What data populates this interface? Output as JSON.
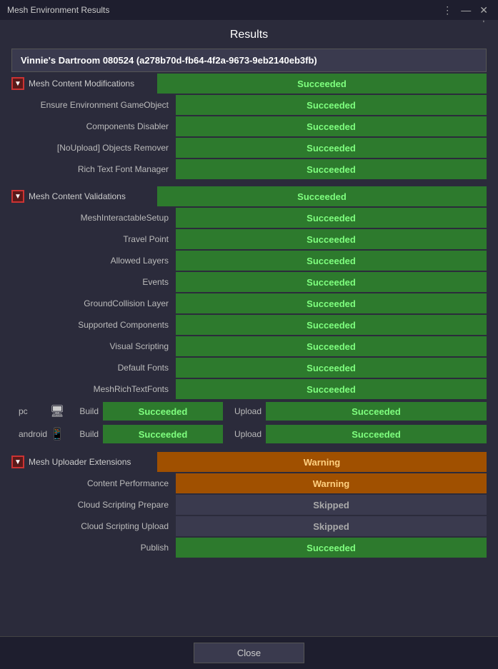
{
  "titleBar": {
    "title": "Mesh Environment Results",
    "moreIcon": "⋮",
    "minimizeIcon": "—",
    "closeIcon": "✕"
  },
  "main": {
    "resultsTitle": "Results",
    "helpIcon": "?",
    "envHeader": "Vinnie's Dartroom 080524 (a278b70d-fb64-4f2a-9673-9eb2140eb3fb)",
    "sections": [
      {
        "id": "mesh-content-modifications",
        "toggle": "▼",
        "title": "Mesh Content Modifications",
        "status": "Succeeded",
        "statusClass": "status-green",
        "rows": [
          {
            "label": "Ensure Environment GameObject",
            "status": "Succeeded",
            "statusClass": "status-green"
          },
          {
            "label": "Components Disabler",
            "status": "Succeeded",
            "statusClass": "status-green"
          },
          {
            "label": "[NoUpload] Objects Remover",
            "status": "Succeeded",
            "statusClass": "status-green"
          },
          {
            "label": "Rich Text Font Manager",
            "status": "Succeeded",
            "statusClass": "status-green"
          }
        ]
      },
      {
        "id": "mesh-content-validations",
        "toggle": "▼",
        "title": "Mesh Content Validations",
        "status": "Succeeded",
        "statusClass": "status-green",
        "rows": [
          {
            "label": "MeshInteractableSetup",
            "status": "Succeeded",
            "statusClass": "status-green"
          },
          {
            "label": "Travel Point",
            "status": "Succeeded",
            "statusClass": "status-green"
          },
          {
            "label": "Allowed Layers",
            "status": "Succeeded",
            "statusClass": "status-green"
          },
          {
            "label": "Events",
            "status": "Succeeded",
            "statusClass": "status-green"
          },
          {
            "label": "GroundCollision Layer",
            "status": "Succeeded",
            "statusClass": "status-green"
          },
          {
            "label": "Supported Components",
            "status": "Succeeded",
            "statusClass": "status-green"
          },
          {
            "label": "Visual Scripting",
            "status": "Succeeded",
            "statusClass": "status-green"
          },
          {
            "label": "Default Fonts",
            "status": "Succeeded",
            "statusClass": "status-green"
          },
          {
            "label": "MeshRichTextFonts",
            "status": "Succeeded",
            "statusClass": "status-green"
          }
        ],
        "buildUploadRows": [
          {
            "platform": "pc",
            "platformIcon": "🖥",
            "buildLabel": "Build",
            "buildStatus": "Succeeded",
            "buildStatusClass": "status-green",
            "uploadLabel": "Upload",
            "uploadStatus": "Succeeded",
            "uploadStatusClass": "status-green"
          },
          {
            "platform": "android",
            "platformIcon": "📱",
            "buildLabel": "Build",
            "buildStatus": "Succeeded",
            "buildStatusClass": "status-green",
            "uploadLabel": "Upload",
            "uploadStatus": "Succeeded",
            "uploadStatusClass": "status-green"
          }
        ]
      },
      {
        "id": "mesh-uploader-extensions",
        "toggle": "▼",
        "title": "Mesh Uploader Extensions",
        "status": "Warning",
        "statusClass": "status-orange",
        "rows": [
          {
            "label": "Content Performance",
            "status": "Warning",
            "statusClass": "status-orange"
          },
          {
            "label": "Cloud Scripting Prepare",
            "status": "Skipped",
            "statusClass": "status-skipped"
          },
          {
            "label": "Cloud Scripting Upload",
            "status": "Skipped",
            "statusClass": "status-skipped"
          },
          {
            "label": "Publish",
            "status": "Succeeded",
            "statusClass": "status-green"
          }
        ]
      }
    ],
    "closeButton": "Close"
  }
}
